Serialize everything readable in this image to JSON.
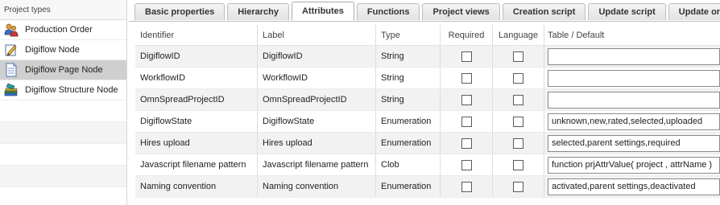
{
  "project_types": {
    "header": "Project types",
    "items": [
      {
        "label": "Production Order",
        "icon": "people-icon",
        "selected": false
      },
      {
        "label": "Digiflow Node",
        "icon": "pencil-icon",
        "selected": false
      },
      {
        "label": "Digiflow Page Node",
        "icon": "page-icon",
        "selected": true
      },
      {
        "label": "Digiflow Structure Node",
        "icon": "books-icon",
        "selected": false
      }
    ]
  },
  "tabs": [
    {
      "label": "Basic properties",
      "active": false
    },
    {
      "label": "Hierarchy",
      "active": false
    },
    {
      "label": "Attributes",
      "active": true
    },
    {
      "label": "Functions",
      "active": false
    },
    {
      "label": "Project views",
      "active": false
    },
    {
      "label": "Creation script",
      "active": false
    },
    {
      "label": "Update script",
      "active": false
    },
    {
      "label": "Update order s",
      "active": false
    }
  ],
  "grid": {
    "columns": {
      "identifier": "Identifier",
      "label": "Label",
      "type": "Type",
      "required": "Required",
      "language": "Language",
      "table_default": "Table / Default"
    },
    "rows": [
      {
        "identifier": "DigiflowID",
        "label": "DigiflowID",
        "type": "String",
        "required": false,
        "language": false,
        "table_default": ""
      },
      {
        "identifier": "WorkflowID",
        "label": "WorkflowID",
        "type": "String",
        "required": false,
        "language": false,
        "table_default": ""
      },
      {
        "identifier": "OmnSpreadProjectID",
        "label": "OmnSpreadProjectID",
        "type": "String",
        "required": false,
        "language": false,
        "table_default": ""
      },
      {
        "identifier": "DigiflowState",
        "label": "DigiflowState",
        "type": "Enumeration",
        "required": false,
        "language": false,
        "table_default": "unknown,new,rated,selected,uploaded"
      },
      {
        "identifier": "Hires upload",
        "label": "Hires upload",
        "type": "Enumeration",
        "required": false,
        "language": false,
        "table_default": "selected,parent settings,required"
      },
      {
        "identifier": "Javascript filename pattern",
        "label": "Javascript filename pattern",
        "type": "Clob",
        "required": false,
        "language": false,
        "table_default": "function prjAttrValue( project , attrName )"
      },
      {
        "identifier": "Naming convention",
        "label": "Naming convention",
        "type": "Enumeration",
        "required": false,
        "language": false,
        "table_default": "activated,parent settings,deactivated"
      }
    ]
  }
}
